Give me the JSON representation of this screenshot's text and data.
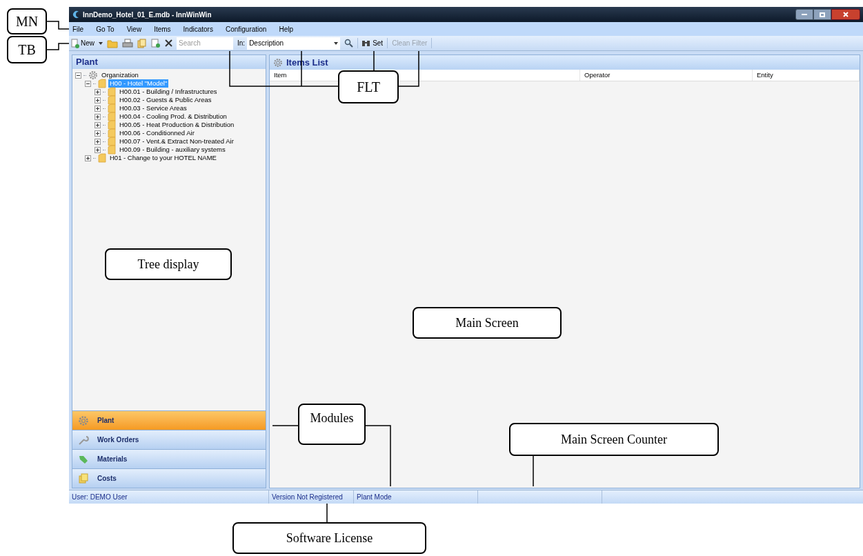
{
  "window": {
    "title": "InnDemo_Hotel_01_E.mdb - InnWinWin"
  },
  "menu": [
    "File",
    "Go To",
    "View",
    "Items",
    "Indicators",
    "Configuration",
    "Help"
  ],
  "toolbar": {
    "new_button": "New",
    "search": {
      "placeholder": "Search"
    },
    "filter_in": {
      "label": "In:",
      "value": "Description"
    },
    "set_button": "Set",
    "clean_filter": {
      "label": "Clean Filter",
      "disabled": true
    }
  },
  "sidebar": {
    "title": "Plant",
    "tree": [
      {
        "label": "Organization",
        "kind": "root",
        "expanded": true,
        "selected": false,
        "children": [
          {
            "label": "H00 - Hotel \"Model\"",
            "kind": "folder",
            "expanded": true,
            "selected": true,
            "children": [
              {
                "label": "H00.01 - Building / Infrastructures",
                "kind": "folder",
                "expanded": false,
                "selected": false
              },
              {
                "label": "H00.02 - Guests & Public Areas",
                "kind": "folder",
                "expanded": false,
                "selected": false
              },
              {
                "label": "H00.03 - Service Areas",
                "kind": "folder",
                "expanded": false,
                "selected": false
              },
              {
                "label": "H00.04 - Cooling Prod. & Distribution",
                "kind": "folder",
                "expanded": false,
                "selected": false
              },
              {
                "label": "H00.05 - Heat Production & Distribution",
                "kind": "folder",
                "expanded": false,
                "selected": false
              },
              {
                "label": "H00.06 - Conditionned Air",
                "kind": "folder",
                "expanded": false,
                "selected": false
              },
              {
                "label": "H00.07 - Vent.& Extract Non-treated Air",
                "kind": "folder",
                "expanded": false,
                "selected": false
              },
              {
                "label": "H00.09 - Building - auxiliary systems",
                "kind": "folder",
                "expanded": false,
                "selected": false
              }
            ]
          },
          {
            "label": "H01 - Change to your HOTEL NAME",
            "kind": "folder",
            "expanded": false,
            "selected": false
          }
        ]
      }
    ],
    "modules": [
      {
        "label": "Plant",
        "kind": "gear",
        "selected": true
      },
      {
        "label": "Work Orders",
        "kind": "wrench",
        "selected": false
      },
      {
        "label": "Materials",
        "kind": "tag",
        "selected": false
      },
      {
        "label": "Costs",
        "kind": "coins",
        "selected": false
      }
    ]
  },
  "items_list": {
    "title": "Items List",
    "columns": [
      "Item",
      "Operator",
      "Entity"
    ]
  },
  "status_bar": [
    "User: DEMO User",
    "Version Not Registered",
    "Plant Mode"
  ],
  "callouts": [
    "MN",
    "TB",
    "FLT",
    "Tree display",
    "Main Screen",
    "Modules",
    "Main Screen Counter",
    "Software License"
  ]
}
